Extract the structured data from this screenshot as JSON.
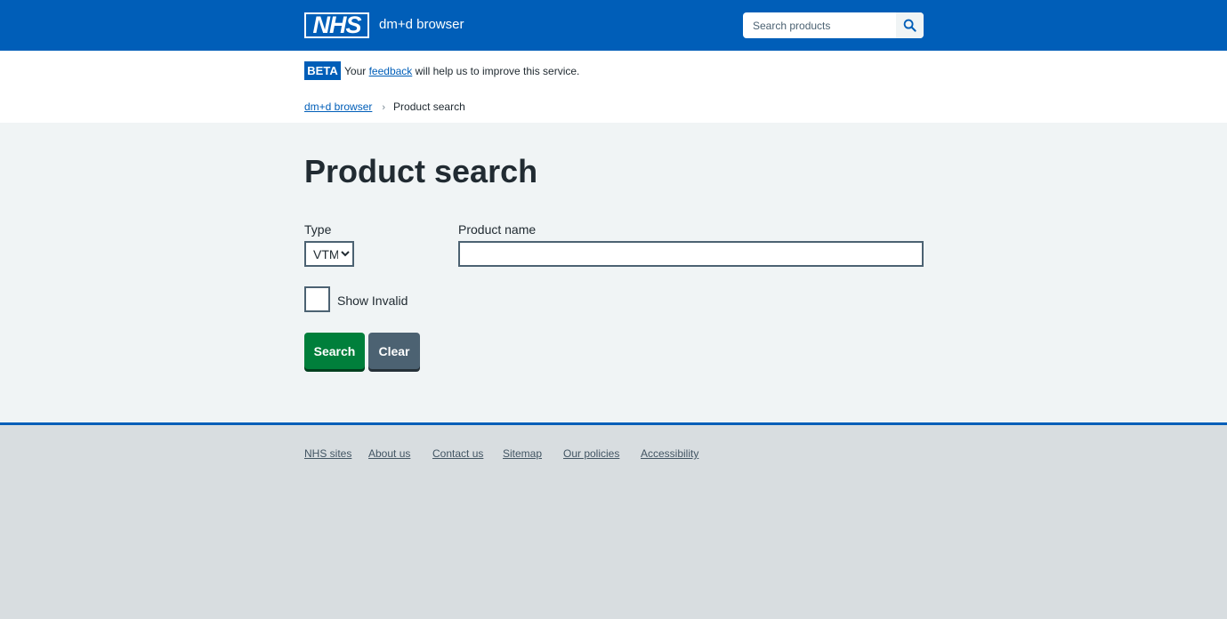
{
  "header": {
    "logo_text": "NHS",
    "service_name": "dm+d browser",
    "search_placeholder": "Search products",
    "search_icon": "search-icon",
    "brand_color": "#005eb8"
  },
  "phase_banner": {
    "tag": "BETA",
    "text_before": "Your ",
    "link_text": "feedback",
    "text_after": " will help us to improve this service."
  },
  "breadcrumb": {
    "home": "dm+d browser",
    "current": "Product search"
  },
  "main": {
    "title": "Product search",
    "type_label": "Type",
    "type_selected": "VTM",
    "product_name_label": "Product name",
    "product_name_value": "",
    "show_invalid_label": "Show Invalid",
    "show_invalid_checked": false,
    "search_button": "Search",
    "clear_button": "Clear",
    "search_button_color": "#007f3b",
    "clear_button_color": "#4c6272"
  },
  "footer": {
    "links": [
      "NHS sites",
      "About us",
      "Contact us",
      "Sitemap",
      "Our policies",
      "Accessibility"
    ]
  }
}
